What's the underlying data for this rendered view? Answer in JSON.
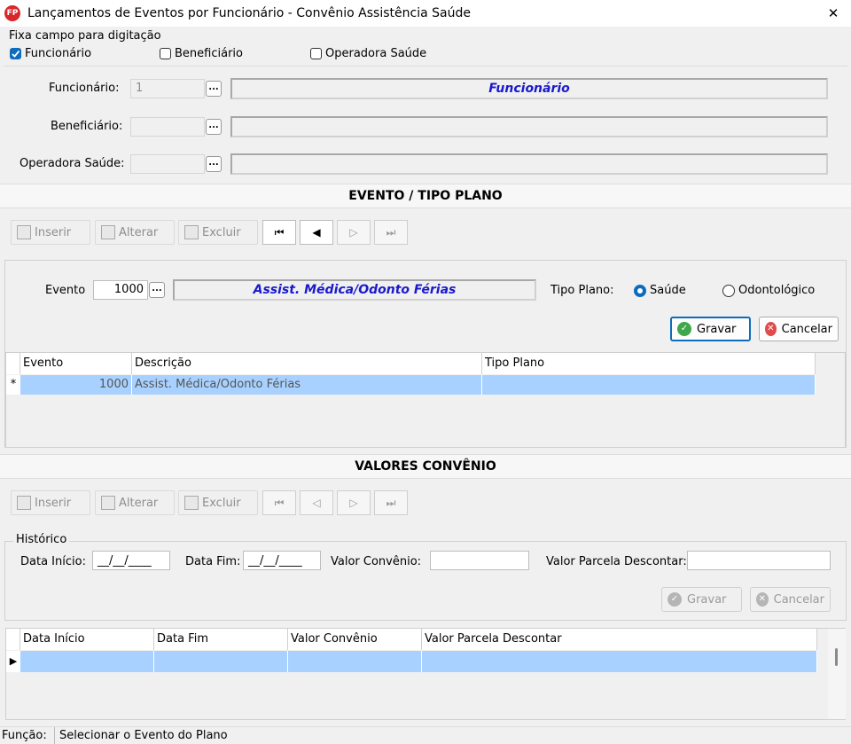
{
  "window": {
    "title": "Lançamentos de Eventos por Funcionário - Convênio Assistência Saúde",
    "icon_text": "FP",
    "close": "✕"
  },
  "fixa": {
    "title": "Fixa campo para digitação",
    "options": [
      {
        "label": "Funcionário",
        "checked": true
      },
      {
        "label": "Beneficiário",
        "checked": false
      },
      {
        "label": "Operadora Saúde",
        "checked": false
      }
    ]
  },
  "fields": {
    "funcionario": {
      "label": "Funcionário:",
      "code": "1",
      "desc": "Funcionário"
    },
    "beneficiario": {
      "label": "Beneficiário:",
      "code": "",
      "desc": ""
    },
    "operadora": {
      "label": "Operadora Saúde:",
      "code": "",
      "desc": ""
    },
    "dots": "..."
  },
  "evento_section": {
    "title": "EVENTO / TIPO PLANO",
    "toolbar": {
      "inserir": "Inserir",
      "alterar": "Alterar",
      "excluir": "Excluir"
    },
    "evento_label": "Evento",
    "evento_code": "1000",
    "evento_desc": "Assist. Médica/Odonto Férias",
    "tipo_plano_label": "Tipo Plano:",
    "tipo_options": [
      {
        "label": "Saúde",
        "selected": true
      },
      {
        "label": "Odontológico",
        "selected": false
      }
    ],
    "gravar": "Gravar",
    "cancelar": "Cancelar",
    "grid_headers": [
      "Evento",
      "Descrição",
      "Tipo Plano"
    ],
    "row": {
      "marker": "*",
      "evento": "1000",
      "descricao": "Assist. Médica/Odonto Férias",
      "tipo": ""
    }
  },
  "valores_section": {
    "title": "VALORES CONVÊNIO",
    "toolbar": {
      "inserir": "Inserir",
      "alterar": "Alterar",
      "excluir": "Excluir"
    },
    "historico": "Histórico",
    "data_inicio_label": "Data Início:",
    "data_inicio_value": "__/__/____",
    "data_fim_label": "Data Fim:",
    "data_fim_value": "__/__/____",
    "valor_convenio_label": "Valor Convênio:",
    "valor_convenio_value": "",
    "valor_parcela_label": "Valor Parcela Descontar:",
    "valor_parcela_value": "",
    "gravar": "Gravar",
    "cancelar": "Cancelar",
    "grid_headers": [
      "Data Início",
      "Data Fim",
      "Valor Convênio",
      "Valor Parcela Descontar"
    ],
    "row_marker": "▶"
  },
  "status": {
    "label": "Função:",
    "text": "Selecionar o Evento do Plano"
  }
}
